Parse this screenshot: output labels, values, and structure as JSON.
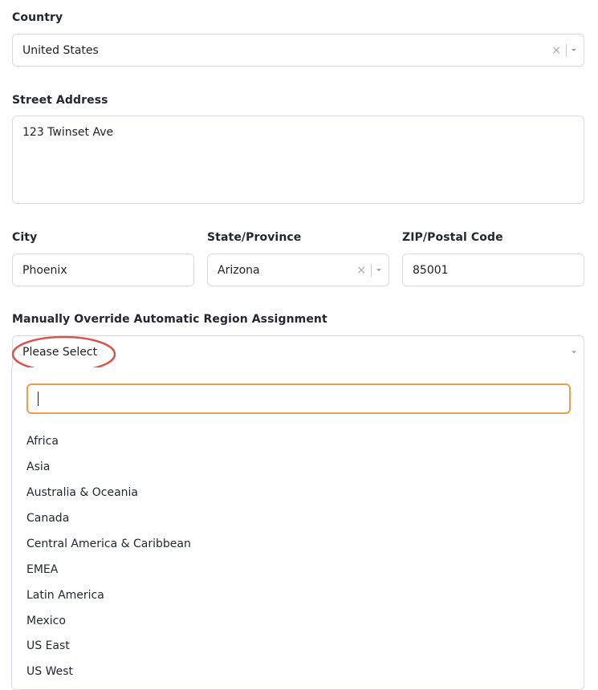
{
  "country": {
    "label": "Country",
    "value": "United States"
  },
  "street": {
    "label": "Street Address",
    "value": "123 Twinset Ave"
  },
  "city": {
    "label": "City",
    "value": "Phoenix"
  },
  "state": {
    "label": "State/Province",
    "value": "Arizona"
  },
  "zip": {
    "label": "ZIP/Postal Code",
    "value": "85001"
  },
  "region": {
    "label": "Manually Override Automatic Region Assignment",
    "placeholder": "Please Select",
    "search_value": "",
    "options": [
      "Africa",
      "Asia",
      "Australia & Oceania",
      "Canada",
      "Central America & Caribbean",
      "EMEA",
      "Latin America",
      "Mexico",
      "US East",
      "US West"
    ]
  },
  "colors": {
    "focus_border": "#e8a04a",
    "annotation": "#d9534f",
    "field_border": "#d7dbe1"
  },
  "icons": {
    "clear": "close-icon",
    "caret": "chevron-down-icon"
  }
}
